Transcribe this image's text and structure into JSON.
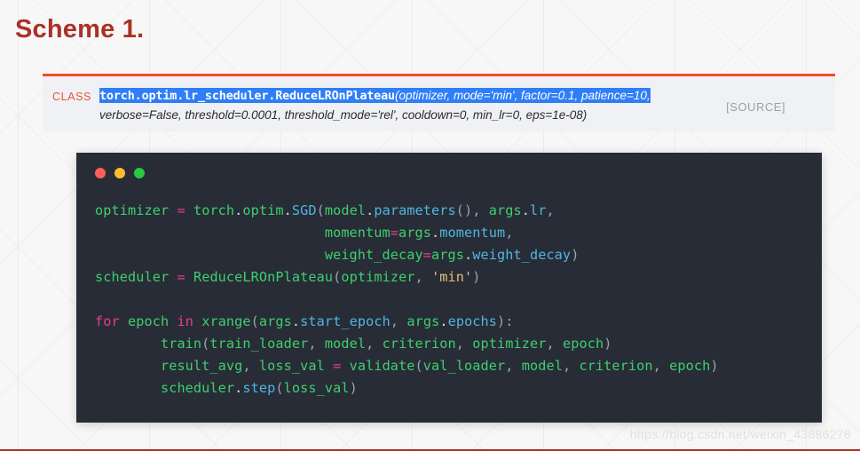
{
  "page": {
    "title": "Scheme 1.",
    "title_color": "#a93226",
    "background_color": "#f7f7f7",
    "watermark": "https://blog.csdn.net/weixin_43886278"
  },
  "signature": {
    "kind_label": "CLASS",
    "kind_label_color": "#e8553a",
    "accent_color": "#ee4c2c",
    "highlight_color": "#2f7ef7",
    "source_label": "[SOURCE]",
    "qualified_name": "torch.optim.lr_scheduler.ReduceLROnPlateau",
    "line1_params": "(optimizer, mode='min', factor=0.1, patience=10,",
    "line1_args": [
      "optimizer",
      "mode='min'",
      "factor=0.1",
      "patience=10"
    ],
    "line2_params": "verbose=False, threshold=0.0001, threshold_mode='rel', cooldown=0, min_lr=0, eps=1e-08)",
    "line2_args": [
      "verbose=False",
      "threshold=0.0001",
      "threshold_mode='rel'",
      "cooldown=0",
      "min_lr=0",
      "eps=1e-08"
    ]
  },
  "code_window": {
    "background_color": "#282c36",
    "dots": [
      {
        "name": "close",
        "color": "#ff5f56"
      },
      {
        "name": "minimize",
        "color": "#ffbd2e"
      },
      {
        "name": "maximize",
        "color": "#27c93f"
      }
    ],
    "language": "python",
    "lines": [
      "optimizer = torch.optim.SGD(model.parameters(), args.lr,",
      "                            momentum=args.momentum,",
      "                            weight_decay=args.weight_decay)",
      "scheduler = ReduceLROnPlateau(optimizer, 'min')",
      "",
      "for epoch in xrange(args.start_epoch, args.epochs):",
      "    train(train_loader, model, criterion, optimizer, epoch)",
      "    result_avg, loss_val = validate(val_loader, model, criterion, epoch)",
      "    scheduler.step(loss_val)"
    ],
    "tokens": {
      "line_1": [
        {
          "t": "optimizer",
          "c": "tok-name"
        },
        {
          "t": " ",
          "c": "tok-plain"
        },
        {
          "t": "=",
          "c": "tok-op"
        },
        {
          "t": " ",
          "c": "tok-plain"
        },
        {
          "t": "torch",
          "c": "tok-name"
        },
        {
          "t": ".",
          "c": "tok-plain"
        },
        {
          "t": "optim",
          "c": "tok-name"
        },
        {
          "t": ".",
          "c": "tok-plain"
        },
        {
          "t": "SGD",
          "c": "tok-attr"
        },
        {
          "t": "(",
          "c": "tok-punct"
        },
        {
          "t": "model",
          "c": "tok-name"
        },
        {
          "t": ".",
          "c": "tok-plain"
        },
        {
          "t": "parameters",
          "c": "tok-attr"
        },
        {
          "t": "(), ",
          "c": "tok-punct"
        },
        {
          "t": "args",
          "c": "tok-name"
        },
        {
          "t": ".",
          "c": "tok-plain"
        },
        {
          "t": "lr",
          "c": "tok-attr"
        },
        {
          "t": ",",
          "c": "tok-punct"
        }
      ],
      "line_2": [
        {
          "t": "                            ",
          "c": "tok-plain"
        },
        {
          "t": "momentum",
          "c": "tok-name"
        },
        {
          "t": "=",
          "c": "tok-op"
        },
        {
          "t": "args",
          "c": "tok-name"
        },
        {
          "t": ".",
          "c": "tok-plain"
        },
        {
          "t": "momentum",
          "c": "tok-attr"
        },
        {
          "t": ",",
          "c": "tok-punct"
        }
      ],
      "line_3": [
        {
          "t": "                            ",
          "c": "tok-plain"
        },
        {
          "t": "weight_decay",
          "c": "tok-name"
        },
        {
          "t": "=",
          "c": "tok-op"
        },
        {
          "t": "args",
          "c": "tok-name"
        },
        {
          "t": ".",
          "c": "tok-plain"
        },
        {
          "t": "weight_decay",
          "c": "tok-attr"
        },
        {
          "t": ")",
          "c": "tok-punct"
        }
      ],
      "line_4": [
        {
          "t": "scheduler",
          "c": "tok-name"
        },
        {
          "t": " ",
          "c": "tok-plain"
        },
        {
          "t": "=",
          "c": "tok-op"
        },
        {
          "t": " ",
          "c": "tok-plain"
        },
        {
          "t": "ReduceLROnPlateau",
          "c": "tok-name"
        },
        {
          "t": "(",
          "c": "tok-punct"
        },
        {
          "t": "optimizer",
          "c": "tok-name"
        },
        {
          "t": ", ",
          "c": "tok-punct"
        },
        {
          "t": "'min'",
          "c": "tok-str"
        },
        {
          "t": ")",
          "c": "tok-punct"
        }
      ],
      "line_5": [],
      "line_6": [
        {
          "t": "for",
          "c": "tok-kw"
        },
        {
          "t": " ",
          "c": "tok-plain"
        },
        {
          "t": "epoch",
          "c": "tok-name"
        },
        {
          "t": " ",
          "c": "tok-plain"
        },
        {
          "t": "in",
          "c": "tok-kw"
        },
        {
          "t": " ",
          "c": "tok-plain"
        },
        {
          "t": "xrange",
          "c": "tok-name"
        },
        {
          "t": "(",
          "c": "tok-punct"
        },
        {
          "t": "args",
          "c": "tok-name"
        },
        {
          "t": ".",
          "c": "tok-plain"
        },
        {
          "t": "start_epoch",
          "c": "tok-attr"
        },
        {
          "t": ", ",
          "c": "tok-punct"
        },
        {
          "t": "args",
          "c": "tok-name"
        },
        {
          "t": ".",
          "c": "tok-plain"
        },
        {
          "t": "epochs",
          "c": "tok-attr"
        },
        {
          "t": "):",
          "c": "tok-punct"
        }
      ],
      "line_7": [
        {
          "t": "        ",
          "c": "tok-plain"
        },
        {
          "t": "train",
          "c": "tok-name"
        },
        {
          "t": "(",
          "c": "tok-punct"
        },
        {
          "t": "train_loader",
          "c": "tok-name"
        },
        {
          "t": ", ",
          "c": "tok-punct"
        },
        {
          "t": "model",
          "c": "tok-name"
        },
        {
          "t": ", ",
          "c": "tok-punct"
        },
        {
          "t": "criterion",
          "c": "tok-name"
        },
        {
          "t": ", ",
          "c": "tok-punct"
        },
        {
          "t": "optimizer",
          "c": "tok-name"
        },
        {
          "t": ", ",
          "c": "tok-punct"
        },
        {
          "t": "epoch",
          "c": "tok-name"
        },
        {
          "t": ")",
          "c": "tok-punct"
        }
      ],
      "line_8": [
        {
          "t": "        ",
          "c": "tok-plain"
        },
        {
          "t": "result_avg",
          "c": "tok-name"
        },
        {
          "t": ", ",
          "c": "tok-punct"
        },
        {
          "t": "loss_val",
          "c": "tok-name"
        },
        {
          "t": " ",
          "c": "tok-plain"
        },
        {
          "t": "=",
          "c": "tok-op"
        },
        {
          "t": " ",
          "c": "tok-plain"
        },
        {
          "t": "validate",
          "c": "tok-name"
        },
        {
          "t": "(",
          "c": "tok-punct"
        },
        {
          "t": "val_loader",
          "c": "tok-name"
        },
        {
          "t": ", ",
          "c": "tok-punct"
        },
        {
          "t": "model",
          "c": "tok-name"
        },
        {
          "t": ", ",
          "c": "tok-punct"
        },
        {
          "t": "criterion",
          "c": "tok-name"
        },
        {
          "t": ", ",
          "c": "tok-punct"
        },
        {
          "t": "epoch",
          "c": "tok-name"
        },
        {
          "t": ")",
          "c": "tok-punct"
        }
      ],
      "line_9": [
        {
          "t": "        ",
          "c": "tok-plain"
        },
        {
          "t": "scheduler",
          "c": "tok-name"
        },
        {
          "t": ".",
          "c": "tok-plain"
        },
        {
          "t": "step",
          "c": "tok-attr"
        },
        {
          "t": "(",
          "c": "tok-punct"
        },
        {
          "t": "loss_val",
          "c": "tok-name"
        },
        {
          "t": ")",
          "c": "tok-punct"
        }
      ]
    }
  }
}
